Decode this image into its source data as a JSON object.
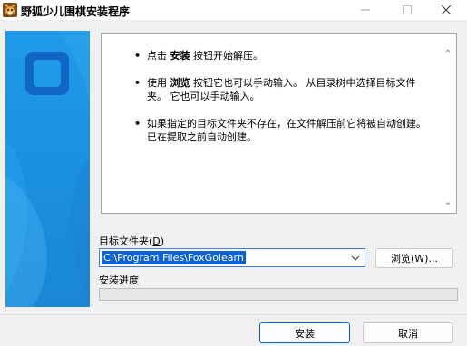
{
  "window": {
    "title": "野狐少儿围棋安装程序",
    "controls": {
      "minimize": "—",
      "maximize": "☐",
      "close": "✕"
    }
  },
  "info": {
    "items": [
      {
        "bullet": "•",
        "before": "点击 ",
        "bold": "安装",
        "after": " 按钮开始解压。"
      },
      {
        "bullet": "•",
        "before": "使用 ",
        "bold": "浏览",
        "after": " 按钮它也可以手动输入。 从目录树中选择目标文件夹。 它也可以手动输入。"
      },
      {
        "bullet": "•",
        "before": "如果指定的目标文件夹不存在，在文件解压前它将被自动创建。 已在提取之前自动创建。",
        "bold": "",
        "after": ""
      }
    ],
    "scroll_up": "⌃",
    "scroll_down": "⌄"
  },
  "folder": {
    "label_prefix": "目标文件夹(",
    "label_key": "D",
    "label_suffix": ")",
    "path": "C:\\Program Files\\FoxGolearn"
  },
  "buttons": {
    "browse": "浏览(W)...",
    "install": "安装",
    "cancel": "取消"
  },
  "progress": {
    "label": "安装进度",
    "value": 0
  },
  "colors": {
    "accent": "#0b63d3",
    "banner": "#1f9ae8",
    "banner_logo": "#1066c7"
  }
}
